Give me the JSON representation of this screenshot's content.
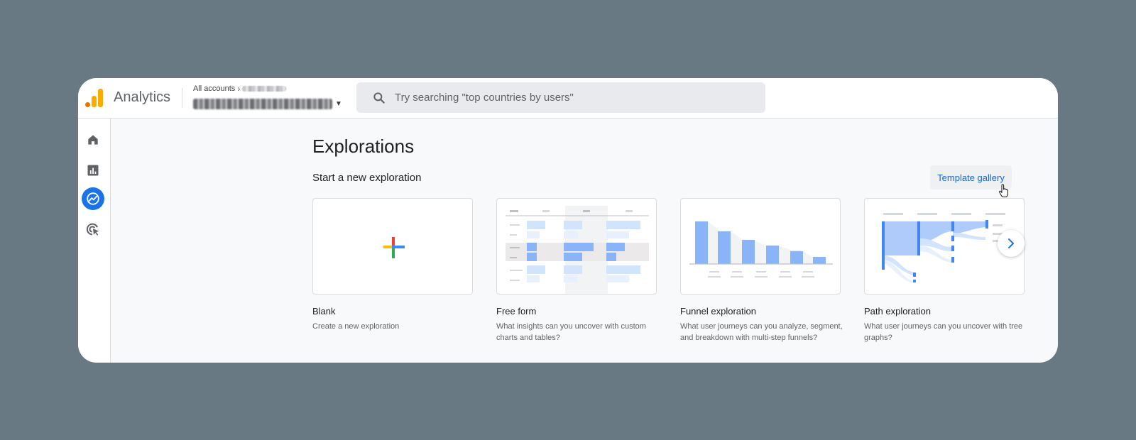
{
  "app": {
    "name": "Analytics"
  },
  "account": {
    "breadcrumb_root": "All accounts"
  },
  "search": {
    "placeholder": "Try searching \"top countries by users\""
  },
  "nav": [
    {
      "name": "home",
      "icon": "home-icon"
    },
    {
      "name": "reports",
      "icon": "bar-chart-icon"
    },
    {
      "name": "explore",
      "icon": "explore-icon",
      "active": true
    },
    {
      "name": "advertising",
      "icon": "target-cursor-icon"
    }
  ],
  "page": {
    "title": "Explorations",
    "subtitle": "Start a new exploration",
    "template_gallery_label": "Template gallery"
  },
  "cards": [
    {
      "title": "Blank",
      "description": "Create a new exploration"
    },
    {
      "title": "Free form",
      "description": "What insights can you uncover with custom charts and tables?"
    },
    {
      "title": "Funnel exploration",
      "description": "What user journeys can you analyze, segment, and breakdown with multi-step funnels?"
    },
    {
      "title": "Path exploration",
      "description": "What user journeys can you uncover with tree graphs?"
    }
  ],
  "colors": {
    "accent": "#1a73e8",
    "link": "#1967d2",
    "logo_orange": "#f9ab00",
    "logo_dark_orange": "#e37400",
    "thumb_blue": "#8ab4f8",
    "thumb_light_blue": "#d2e3fc"
  }
}
